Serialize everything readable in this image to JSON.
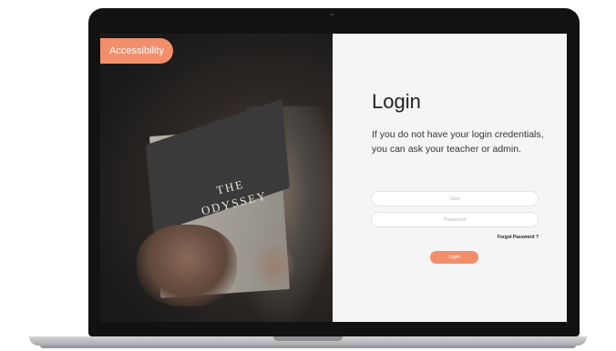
{
  "accessibility_button": {
    "label": "Accessibility"
  },
  "photo": {
    "book_title": "THE ODYSSEY"
  },
  "login": {
    "title": "Login",
    "description": "If you do not have your login credentials, you can ask your teacher or admin.",
    "user_placeholder": "User",
    "user_value": "",
    "password_placeholder": "Password",
    "password_value": "",
    "forgot_label": "Forgot Password ?",
    "submit_label": "Login"
  },
  "colors": {
    "accent": "#f28e6a",
    "panel_background": "#f5f5f5",
    "bezel": "#121212"
  }
}
